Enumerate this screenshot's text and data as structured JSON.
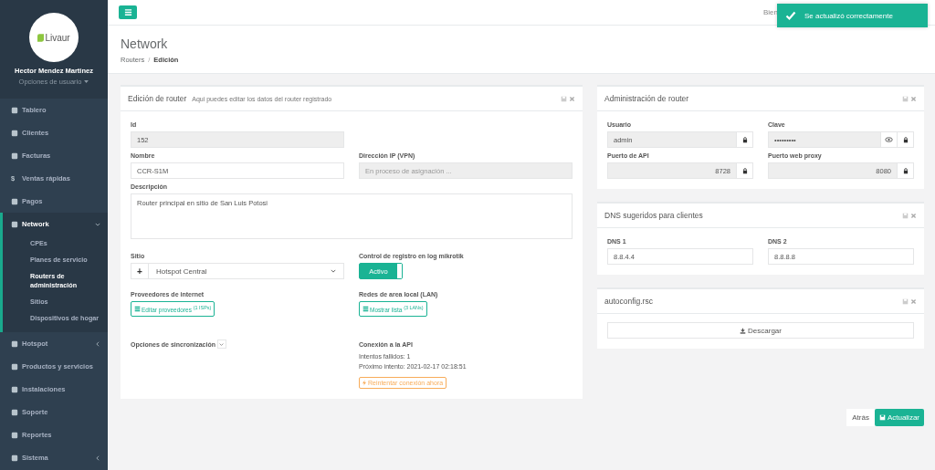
{
  "sidebar": {
    "brand": "Livaur",
    "user_name": "Hector Mendez Martinez",
    "user_options": "Opciones de usuario",
    "items": [
      {
        "label": "Tablero",
        "selected": false
      },
      {
        "label": "Clientes",
        "selected": false
      },
      {
        "label": "Facturas",
        "selected": false
      },
      {
        "label": "Ventas rápidas",
        "glyph": "$",
        "selected": false
      },
      {
        "label": "Pagos",
        "selected": false
      },
      {
        "label": "Network",
        "selected": true,
        "expanded": true,
        "children": [
          {
            "label": "CPEs",
            "selected": false
          },
          {
            "label": "Planes de servicio",
            "selected": false
          },
          {
            "label": "Routers de administración",
            "selected": true
          },
          {
            "label": "Sitios",
            "selected": false
          },
          {
            "label": "Dispositivos de hogar",
            "selected": false
          }
        ]
      },
      {
        "label": "Hotspot",
        "selected": false,
        "expanded": false
      },
      {
        "label": "Productos y servicios",
        "selected": false
      },
      {
        "label": "Instalaciones",
        "selected": false
      },
      {
        "label": "Soporte",
        "selected": false
      },
      {
        "label": "Reportes",
        "selected": false
      },
      {
        "label": "Sistema",
        "selected": false,
        "expanded": false
      }
    ]
  },
  "topbar": {
    "greeting": "Bien"
  },
  "toast": {
    "message": "Se actualizó correctamente"
  },
  "page": {
    "title": "Network",
    "separator": "/",
    "breadcrumb": [
      {
        "label": "Routers",
        "current": false
      },
      {
        "label": "Edición",
        "current": true
      }
    ]
  },
  "router_panel": {
    "title": "Edición de router",
    "subtitle": "Aqui puedes editar los datos del router registrado",
    "id": {
      "label": "Id",
      "value": "152"
    },
    "name": {
      "label": "Nombre",
      "value": "CCR-S1M"
    },
    "ip": {
      "label": "Dirección IP (VPN)",
      "placeholder": "En proceso de asignación ..."
    },
    "description": {
      "label": "Descripción",
      "value": "Router principal en sitio de San Luis Potosi"
    },
    "site": {
      "label": "Sitio",
      "add": "+",
      "value": "Hotspot Central"
    },
    "log_control": {
      "label": "Control de registro en log mikrotik",
      "toggle": "Activo",
      "on": true
    },
    "providers": {
      "label": "Proveedores de internet",
      "button": "Editar proveedores $^{(1 ISPs)}$"
    },
    "lan": {
      "label": "Redes de area local (LAN)",
      "button": "Mostrar lista $^{(3 LANs)}$"
    },
    "sync": {
      "label": "Opciones de sincronización",
      "expanded": false
    },
    "api": {
      "label": "Conexión a la API",
      "failed": "Intentos fallidos: 1",
      "next": "Próximo intento: 2021-02-17 02:18:51",
      "retry": "Reintentar conexión ahora"
    }
  },
  "admin_panel": {
    "title": "Administración de router",
    "fields": [
      {
        "label": "Usuario",
        "value": "admin",
        "kind": "text",
        "reveal": false
      },
      {
        "label": "Clave",
        "value": "•••••••••",
        "kind": "text",
        "reveal": true
      },
      {
        "label": "Puerto de API",
        "value": "8728",
        "kind": "number",
        "reveal": false
      },
      {
        "label": "Puerto web proxy",
        "value": "8080",
        "kind": "number",
        "reveal": false
      }
    ]
  },
  "dns_panel": {
    "title": "DNS sugeridos para clientes",
    "fields": [
      {
        "label": "DNS 1",
        "value": "8.8.4.4"
      },
      {
        "label": "DNS 2",
        "value": "8.8.8.8"
      }
    ]
  },
  "autoconfig_panel": {
    "title": "autoconfig.rsc",
    "button": "Descargar"
  },
  "actions": {
    "back": "Atrás",
    "submit": "Actualizar"
  }
}
